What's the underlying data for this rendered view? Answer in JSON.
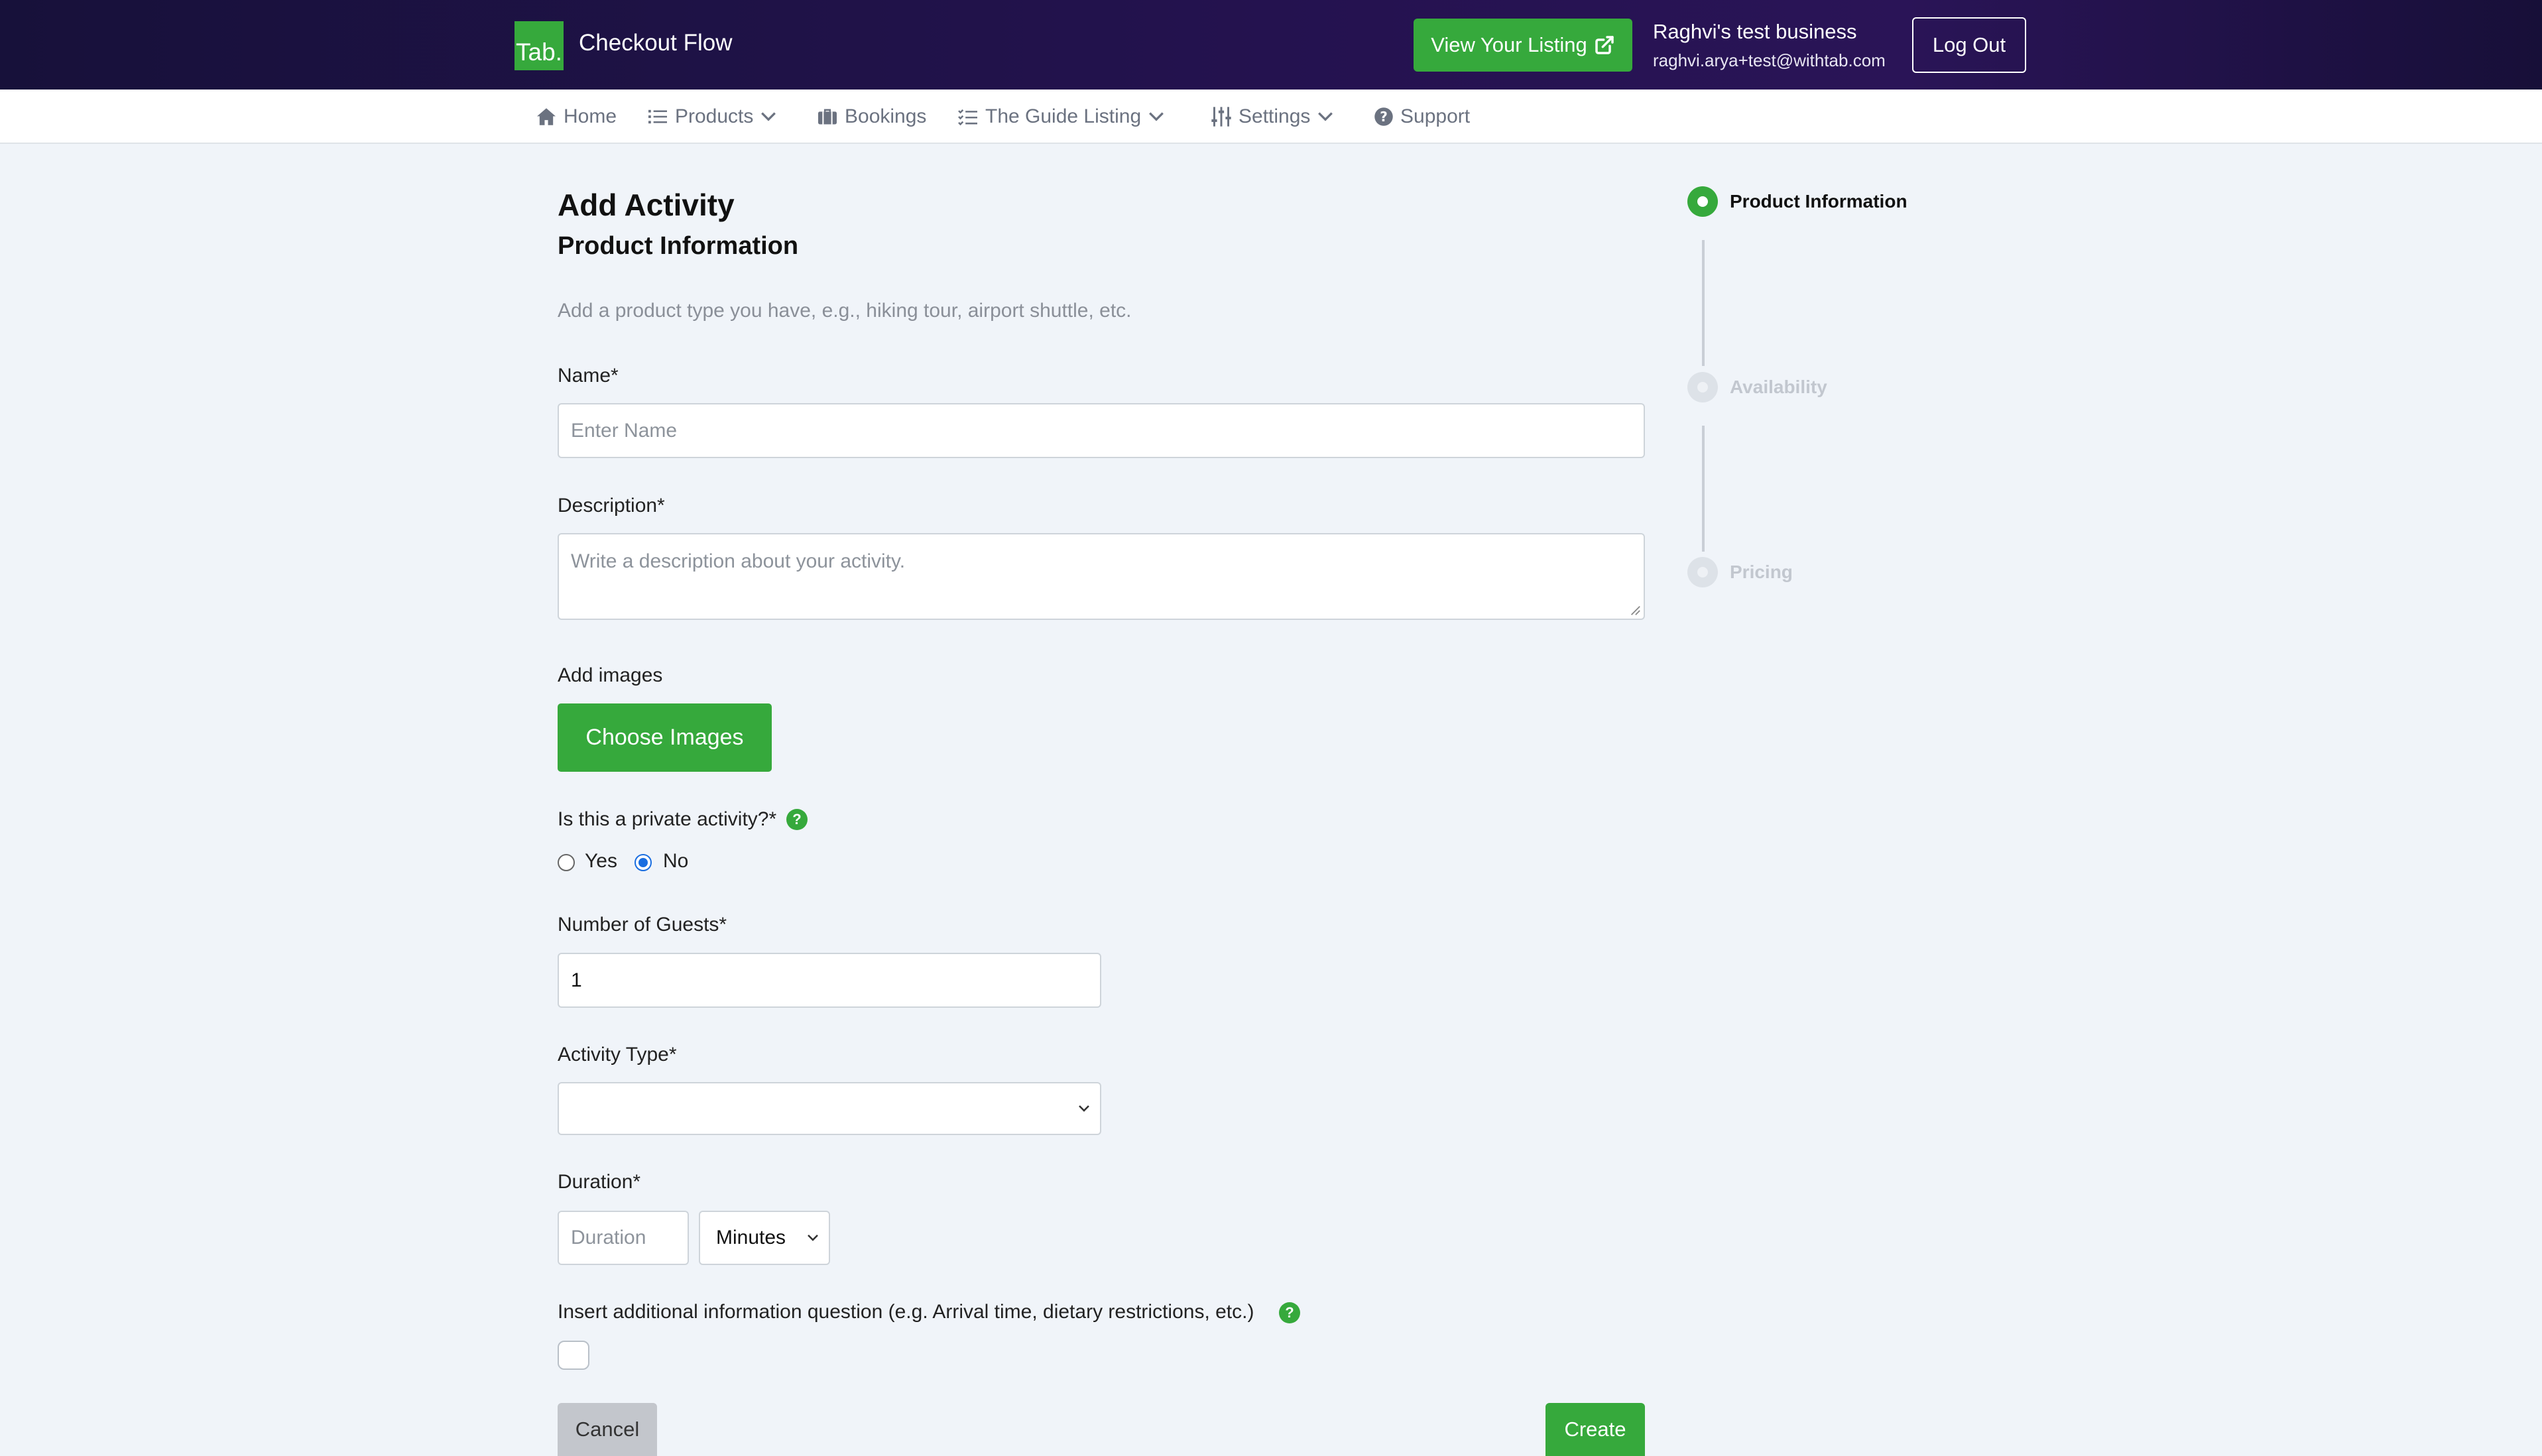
{
  "header": {
    "logo_text": "Tab.",
    "title": "Checkout Flow",
    "view_listing_label": "View Your Listing",
    "business_name": "Raghvi's test business",
    "business_email": "raghvi.arya+test@withtab.com",
    "logout_label": "Log Out"
  },
  "nav": {
    "items": [
      {
        "label": "Home",
        "icon": "home-icon"
      },
      {
        "label": "Products",
        "icon": "list-icon",
        "dropdown": true
      },
      {
        "label": "Bookings",
        "icon": "briefcase-icon"
      },
      {
        "label": "The Guide Listing",
        "icon": "checklist-icon",
        "dropdown": true
      },
      {
        "label": "Settings",
        "icon": "sliders-icon",
        "dropdown": true
      },
      {
        "label": "Support",
        "icon": "question-circle-icon"
      }
    ]
  },
  "form": {
    "heading": "Add Activity",
    "subheading": "Product Information",
    "subtitle": "Add a product type you have, e.g., hiking tour, airport shuttle, etc.",
    "name": {
      "label": "Name*",
      "value": "",
      "placeholder": "Enter Name"
    },
    "description": {
      "label": "Description*",
      "value": "",
      "placeholder": "Write a description about your activity."
    },
    "images": {
      "label": "Add images",
      "button_label": "Choose Images"
    },
    "private": {
      "label": "Is this a private activity?*",
      "options": [
        {
          "label": "Yes",
          "checked": false
        },
        {
          "label": "No",
          "checked": true
        }
      ]
    },
    "guests": {
      "label": "Number of Guests*",
      "value": "1"
    },
    "activity_type": {
      "label": "Activity Type*",
      "value": ""
    },
    "duration": {
      "label": "Duration*",
      "placeholder": "Duration",
      "value": "",
      "unit": "Minutes"
    },
    "additional_info": {
      "label": "Insert additional information question (e.g. Arrival time, dietary restrictions, etc.)",
      "checked": false
    },
    "cancel_label": "Cancel",
    "create_label": "Create"
  },
  "stepper": {
    "steps": [
      {
        "label": "Product Information",
        "active": true
      },
      {
        "label": "Availability",
        "active": false
      },
      {
        "label": "Pricing",
        "active": false
      }
    ]
  },
  "colors": {
    "brand_green": "#36a93c",
    "header_dark": "#1e1245",
    "radio_blue": "#1a6ee0"
  }
}
